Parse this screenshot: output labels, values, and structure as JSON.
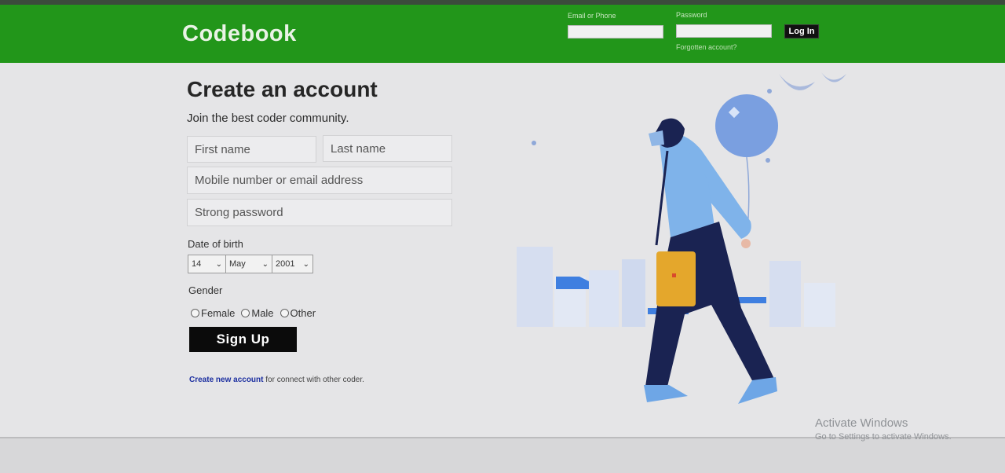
{
  "header": {
    "logo": "Codebook",
    "email_label": "Email or Phone",
    "password_label": "Password",
    "login_button": "Log In",
    "forgot_link": "Forgotten account?"
  },
  "form": {
    "title": "Create an account",
    "subtitle": "Join the best coder community.",
    "first_name_placeholder": "First name",
    "last_name_placeholder": "Last name",
    "contact_placeholder": "Mobile number or email address",
    "password_placeholder": "Strong password",
    "dob_label": "Date of birth",
    "dob": {
      "day": "14",
      "month": "May",
      "year": "2001"
    },
    "gender_label": "Gender",
    "gender_options": [
      "Female",
      "Male",
      "Other"
    ],
    "signup_button": "Sign Up",
    "bottom_link": "Create new account",
    "bottom_text": " for connect with other coder."
  },
  "watermark": {
    "line1": "Activate Windows",
    "line2": "Go to Settings to activate Windows."
  },
  "colors": {
    "header_green": "#22961a",
    "button_black": "#0b0b0b",
    "link_blue": "#1c2fa0",
    "illustration_blue": "#7a9fe0"
  },
  "icons": {
    "dropdown": "chevron-down-icon",
    "radio": "radio-icon"
  }
}
